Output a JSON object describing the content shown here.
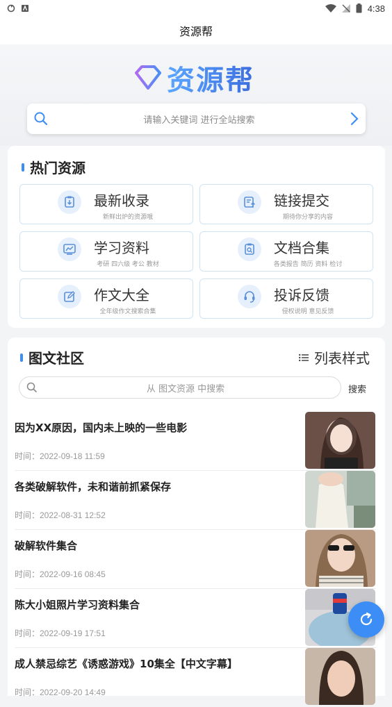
{
  "status_bar": {
    "time": "4:38"
  },
  "app_bar": {
    "title": "资源帮"
  },
  "hero": {
    "logo_text": "资源帮"
  },
  "search": {
    "placeholder": "请输入关键词 进行全站搜索"
  },
  "hot": {
    "title": "热门资源",
    "items": [
      {
        "title": "最新收录",
        "subtitle": "新鲜出炉的资源哦",
        "icon": "download-doc-icon"
      },
      {
        "title": "链接提交",
        "subtitle": "期待你分享的内容",
        "icon": "upload-doc-icon"
      },
      {
        "title": "学习资料",
        "subtitle": "考研 四六级 考公 教材",
        "icon": "chart-icon"
      },
      {
        "title": "文档合集",
        "subtitle": "各类报告 简历 资料 检讨",
        "icon": "doc-search-icon"
      },
      {
        "title": "作文大全",
        "subtitle": "全年级作文搜索合集",
        "icon": "edit-icon"
      },
      {
        "title": "投诉反馈",
        "subtitle": "侵权说明 意见反馈",
        "icon": "headset-icon"
      }
    ]
  },
  "community": {
    "title": "图文社区",
    "list_style_label": "列表样式",
    "search_placeholder": "从 图文资源 中搜索",
    "search_button": "搜索",
    "posts": [
      {
        "title": "因为XX原因，国内未上映的一些电影",
        "time": "时间：2022-09-18 11:59"
      },
      {
        "title": "各类破解软件，未和谐前抓紧保存",
        "time": "时间：2022-08-31 12:52"
      },
      {
        "title": "破解软件集合",
        "time": "时间：2022-09-16 08:45"
      },
      {
        "title": "陈大小姐照片学习资料集合",
        "time": "时间：2022-09-19 17:51"
      },
      {
        "title": "成人禁忌综艺《诱惑游戏》10集全【中文字幕】",
        "time": "时间：2022-09-20 14:49"
      }
    ]
  },
  "colors": {
    "accent": "#3c8df5",
    "border": "#cfe3f7"
  }
}
